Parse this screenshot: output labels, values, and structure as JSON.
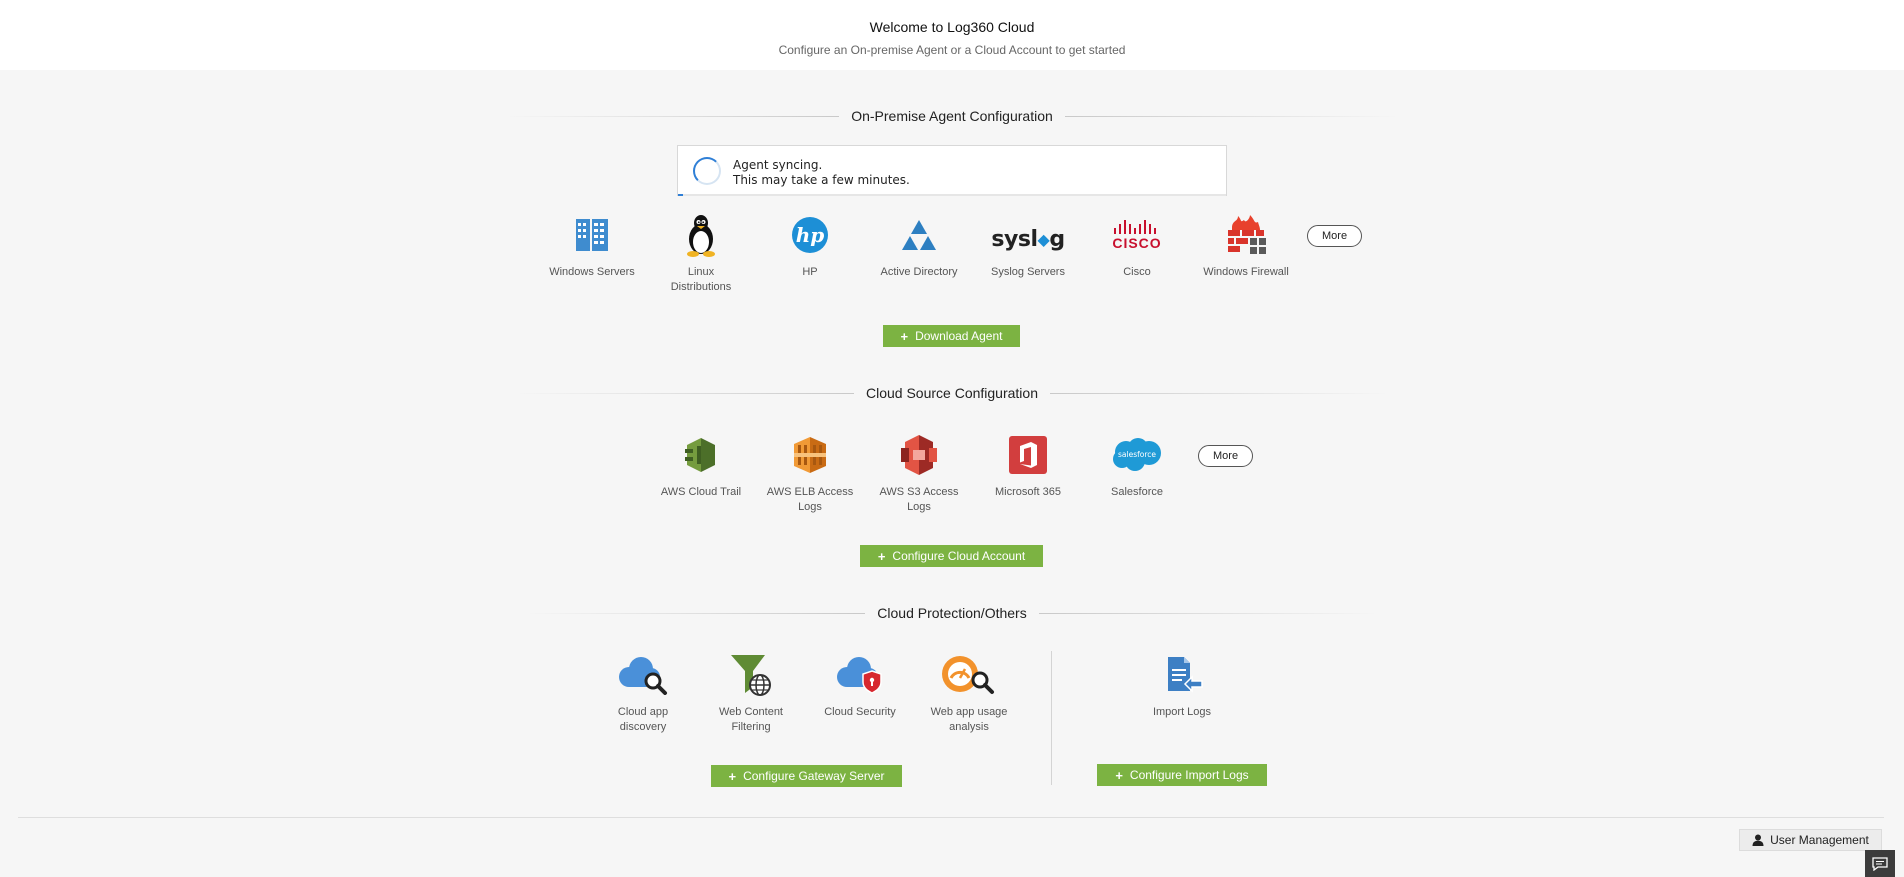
{
  "header": {
    "title": "Welcome to Log360 Cloud",
    "subtitle": "Configure an On-premise Agent or a Cloud Account to get started"
  },
  "on_premise": {
    "heading": "On-Premise Agent Configuration",
    "sync_line1": "Agent syncing.",
    "sync_line2": "This may take a few minutes.",
    "sync_progress_percent": 1,
    "tiles": [
      {
        "label": "Windows Servers",
        "icon": "windows-servers-icon"
      },
      {
        "label": "Linux Distributions",
        "icon": "linux-tux-icon"
      },
      {
        "label": "HP",
        "icon": "hp-logo-icon"
      },
      {
        "label": "Active Directory",
        "icon": "active-directory-icon"
      },
      {
        "label": "Syslog Servers",
        "icon": "syslog-logo-icon"
      },
      {
        "label": "Cisco",
        "icon": "cisco-logo-icon"
      },
      {
        "label": "Windows Firewall",
        "icon": "firewall-icon"
      }
    ],
    "syslog_text": "sysl",
    "syslog_text2": "g",
    "cisco_text": "CISCO",
    "more_label": "More",
    "download_label": "Download Agent"
  },
  "cloud_source": {
    "heading": "Cloud Source Configuration",
    "tiles": [
      {
        "label": "AWS Cloud Trail",
        "icon": "aws-cloudtrail-icon"
      },
      {
        "label": "AWS ELB Access Logs",
        "icon": "aws-elb-icon"
      },
      {
        "label": "AWS S3 Access Logs",
        "icon": "aws-s3-icon"
      },
      {
        "label": "Microsoft 365",
        "icon": "microsoft-365-icon"
      },
      {
        "label": "Salesforce",
        "icon": "salesforce-icon"
      }
    ],
    "salesforce_text": "salesforce",
    "more_label": "More",
    "configure_label": "Configure Cloud Account"
  },
  "cloud_protection": {
    "heading": "Cloud Protection/Others",
    "tiles": [
      {
        "label": "Cloud app discovery",
        "icon": "cloud-app-discovery-icon"
      },
      {
        "label": "Web Content Filtering",
        "icon": "web-content-filter-icon"
      },
      {
        "label": "Cloud Security",
        "icon": "cloud-security-icon"
      },
      {
        "label": "Web app usage analysis",
        "icon": "web-app-usage-icon"
      },
      {
        "label": "Import Logs",
        "icon": "import-logs-icon"
      }
    ],
    "gateway_label": "Configure Gateway Server",
    "import_label": "Configure Import Logs"
  },
  "footer": {
    "user_management_label": "User Management"
  },
  "colors": {
    "accent_green": "#7cb342",
    "spinner_blue": "#2f7fd6",
    "background": "#f6f6f6"
  }
}
